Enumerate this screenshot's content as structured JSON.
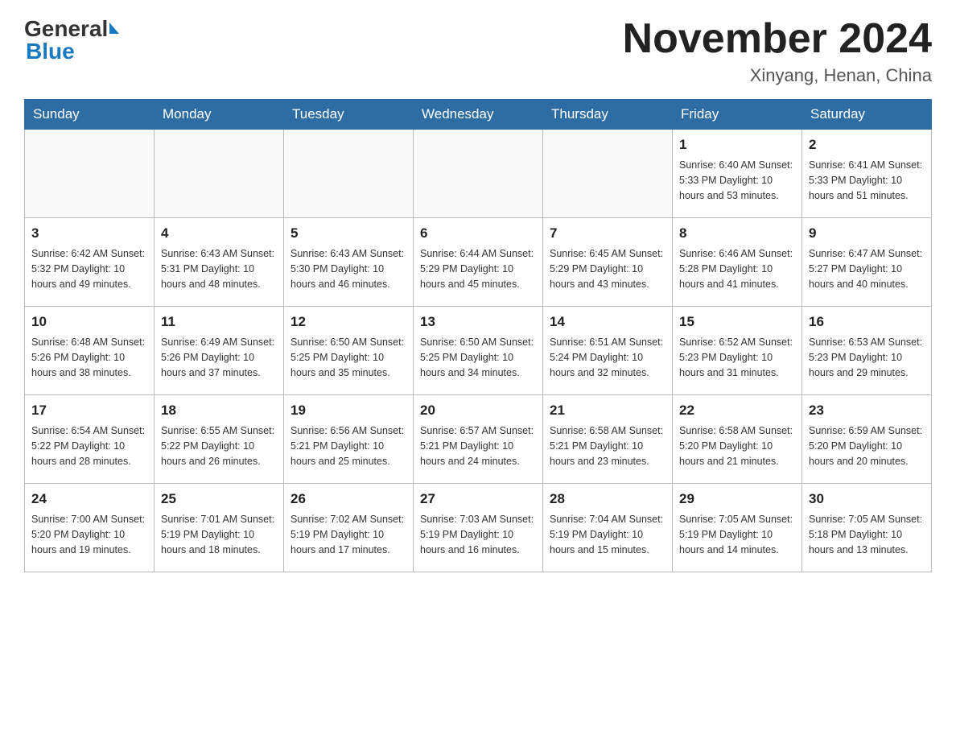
{
  "header": {
    "month_year": "November 2024",
    "location": "Xinyang, Henan, China",
    "logo_general": "General",
    "logo_blue": "Blue"
  },
  "weekdays": [
    "Sunday",
    "Monday",
    "Tuesday",
    "Wednesday",
    "Thursday",
    "Friday",
    "Saturday"
  ],
  "weeks": [
    {
      "days": [
        {
          "number": "",
          "info": ""
        },
        {
          "number": "",
          "info": ""
        },
        {
          "number": "",
          "info": ""
        },
        {
          "number": "",
          "info": ""
        },
        {
          "number": "",
          "info": ""
        },
        {
          "number": "1",
          "info": "Sunrise: 6:40 AM\nSunset: 5:33 PM\nDaylight: 10 hours\nand 53 minutes."
        },
        {
          "number": "2",
          "info": "Sunrise: 6:41 AM\nSunset: 5:33 PM\nDaylight: 10 hours\nand 51 minutes."
        }
      ]
    },
    {
      "days": [
        {
          "number": "3",
          "info": "Sunrise: 6:42 AM\nSunset: 5:32 PM\nDaylight: 10 hours\nand 49 minutes."
        },
        {
          "number": "4",
          "info": "Sunrise: 6:43 AM\nSunset: 5:31 PM\nDaylight: 10 hours\nand 48 minutes."
        },
        {
          "number": "5",
          "info": "Sunrise: 6:43 AM\nSunset: 5:30 PM\nDaylight: 10 hours\nand 46 minutes."
        },
        {
          "number": "6",
          "info": "Sunrise: 6:44 AM\nSunset: 5:29 PM\nDaylight: 10 hours\nand 45 minutes."
        },
        {
          "number": "7",
          "info": "Sunrise: 6:45 AM\nSunset: 5:29 PM\nDaylight: 10 hours\nand 43 minutes."
        },
        {
          "number": "8",
          "info": "Sunrise: 6:46 AM\nSunset: 5:28 PM\nDaylight: 10 hours\nand 41 minutes."
        },
        {
          "number": "9",
          "info": "Sunrise: 6:47 AM\nSunset: 5:27 PM\nDaylight: 10 hours\nand 40 minutes."
        }
      ]
    },
    {
      "days": [
        {
          "number": "10",
          "info": "Sunrise: 6:48 AM\nSunset: 5:26 PM\nDaylight: 10 hours\nand 38 minutes."
        },
        {
          "number": "11",
          "info": "Sunrise: 6:49 AM\nSunset: 5:26 PM\nDaylight: 10 hours\nand 37 minutes."
        },
        {
          "number": "12",
          "info": "Sunrise: 6:50 AM\nSunset: 5:25 PM\nDaylight: 10 hours\nand 35 minutes."
        },
        {
          "number": "13",
          "info": "Sunrise: 6:50 AM\nSunset: 5:25 PM\nDaylight: 10 hours\nand 34 minutes."
        },
        {
          "number": "14",
          "info": "Sunrise: 6:51 AM\nSunset: 5:24 PM\nDaylight: 10 hours\nand 32 minutes."
        },
        {
          "number": "15",
          "info": "Sunrise: 6:52 AM\nSunset: 5:23 PM\nDaylight: 10 hours\nand 31 minutes."
        },
        {
          "number": "16",
          "info": "Sunrise: 6:53 AM\nSunset: 5:23 PM\nDaylight: 10 hours\nand 29 minutes."
        }
      ]
    },
    {
      "days": [
        {
          "number": "17",
          "info": "Sunrise: 6:54 AM\nSunset: 5:22 PM\nDaylight: 10 hours\nand 28 minutes."
        },
        {
          "number": "18",
          "info": "Sunrise: 6:55 AM\nSunset: 5:22 PM\nDaylight: 10 hours\nand 26 minutes."
        },
        {
          "number": "19",
          "info": "Sunrise: 6:56 AM\nSunset: 5:21 PM\nDaylight: 10 hours\nand 25 minutes."
        },
        {
          "number": "20",
          "info": "Sunrise: 6:57 AM\nSunset: 5:21 PM\nDaylight: 10 hours\nand 24 minutes."
        },
        {
          "number": "21",
          "info": "Sunrise: 6:58 AM\nSunset: 5:21 PM\nDaylight: 10 hours\nand 23 minutes."
        },
        {
          "number": "22",
          "info": "Sunrise: 6:58 AM\nSunset: 5:20 PM\nDaylight: 10 hours\nand 21 minutes."
        },
        {
          "number": "23",
          "info": "Sunrise: 6:59 AM\nSunset: 5:20 PM\nDaylight: 10 hours\nand 20 minutes."
        }
      ]
    },
    {
      "days": [
        {
          "number": "24",
          "info": "Sunrise: 7:00 AM\nSunset: 5:20 PM\nDaylight: 10 hours\nand 19 minutes."
        },
        {
          "number": "25",
          "info": "Sunrise: 7:01 AM\nSunset: 5:19 PM\nDaylight: 10 hours\nand 18 minutes."
        },
        {
          "number": "26",
          "info": "Sunrise: 7:02 AM\nSunset: 5:19 PM\nDaylight: 10 hours\nand 17 minutes."
        },
        {
          "number": "27",
          "info": "Sunrise: 7:03 AM\nSunset: 5:19 PM\nDaylight: 10 hours\nand 16 minutes."
        },
        {
          "number": "28",
          "info": "Sunrise: 7:04 AM\nSunset: 5:19 PM\nDaylight: 10 hours\nand 15 minutes."
        },
        {
          "number": "29",
          "info": "Sunrise: 7:05 AM\nSunset: 5:19 PM\nDaylight: 10 hours\nand 14 minutes."
        },
        {
          "number": "30",
          "info": "Sunrise: 7:05 AM\nSunset: 5:18 PM\nDaylight: 10 hours\nand 13 minutes."
        }
      ]
    }
  ]
}
